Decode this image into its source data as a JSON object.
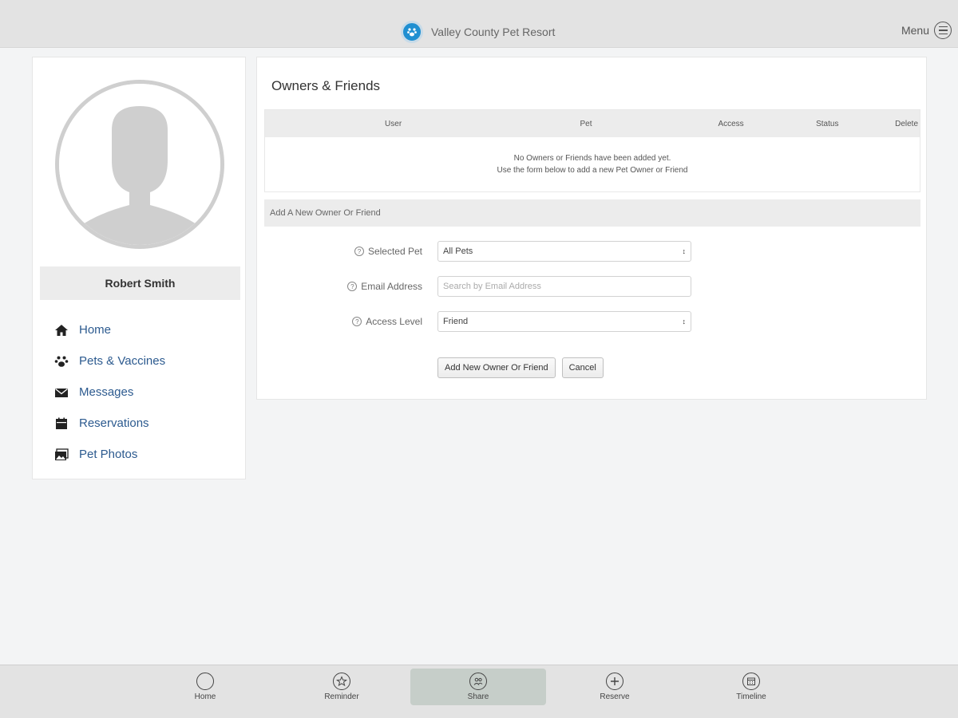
{
  "header": {
    "title": "Valley County Pet Resort",
    "menu_label": "Menu",
    "logo_icon": "paw-logo-icon",
    "brand_color": "#1f8fd1"
  },
  "profile": {
    "name": "Robert Smith",
    "avatar_icon": "user-silhouette-icon"
  },
  "sidebar": {
    "items": [
      {
        "label": "Home",
        "icon": "home-icon"
      },
      {
        "label": "Pets & Vaccines",
        "icon": "paw-icon"
      },
      {
        "label": "Messages",
        "icon": "envelope-icon"
      },
      {
        "label": "Reservations",
        "icon": "calendar-icon"
      },
      {
        "label": "Pet Photos",
        "icon": "photos-icon"
      }
    ],
    "link_color": "#2c5a8f"
  },
  "main": {
    "title": "Owners & Friends",
    "table": {
      "columns": [
        "User",
        "Pet",
        "Access",
        "Status",
        "Delete"
      ],
      "empty_line1": "No Owners or Friends have been added yet.",
      "empty_line2": "Use the form below to add a new Pet Owner or Friend"
    },
    "form": {
      "section_title": "Add A New Owner Or Friend",
      "selected_pet_label": "Selected Pet",
      "selected_pet_value": "All Pets",
      "email_label": "Email Address",
      "email_placeholder": "Search by Email Address",
      "access_label": "Access Level",
      "access_value": "Friend",
      "submit_label": "Add New Owner Or Friend",
      "cancel_label": "Cancel"
    }
  },
  "tabbar": {
    "tabs": [
      {
        "label": "Home",
        "icon": "home-circle-icon",
        "active": false
      },
      {
        "label": "Reminder",
        "icon": "star-icon",
        "active": false
      },
      {
        "label": "Share",
        "icon": "share-icon",
        "active": true
      },
      {
        "label": "Reserve",
        "icon": "plus-icon",
        "active": false
      },
      {
        "label": "Timeline",
        "icon": "timeline-icon",
        "active": false
      }
    ],
    "active_color": "#c6cec9"
  }
}
